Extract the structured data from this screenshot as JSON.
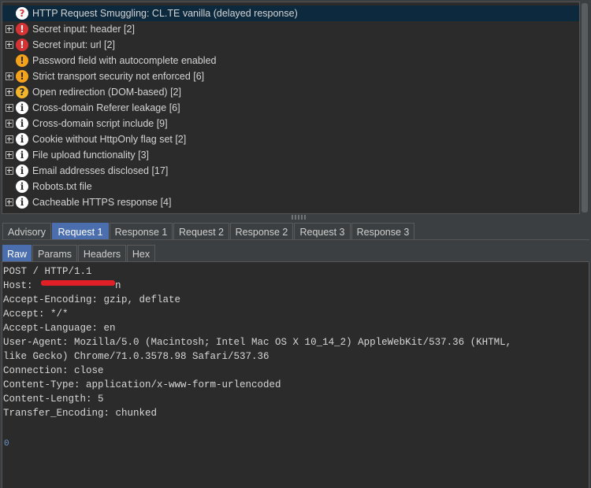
{
  "issues": [
    {
      "label": "HTTP Request Smuggling: CL.TE vanilla (delayed response)",
      "severity": "high-tentative",
      "glyph": "?",
      "expandable": false,
      "selected": true
    },
    {
      "label": "Secret input: header [2]",
      "severity": "high",
      "glyph": "!",
      "expandable": true,
      "selected": false
    },
    {
      "label": "Secret input: url [2]",
      "severity": "high",
      "glyph": "!",
      "expandable": true,
      "selected": false
    },
    {
      "label": "Password field with autocomplete enabled",
      "severity": "medium",
      "glyph": "!",
      "expandable": false,
      "selected": false
    },
    {
      "label": "Strict transport security not enforced [6]",
      "severity": "medium",
      "glyph": "!",
      "expandable": true,
      "selected": false
    },
    {
      "label": "Open redirection (DOM-based) [2]",
      "severity": "medium-tentative",
      "glyph": "?",
      "expandable": true,
      "selected": false
    },
    {
      "label": "Cross-domain Referer leakage [6]",
      "severity": "info",
      "glyph": "i",
      "expandable": true,
      "selected": false
    },
    {
      "label": "Cross-domain script include [9]",
      "severity": "info",
      "glyph": "i",
      "expandable": true,
      "selected": false
    },
    {
      "label": "Cookie without HttpOnly flag set [2]",
      "severity": "info",
      "glyph": "i",
      "expandable": true,
      "selected": false
    },
    {
      "label": "File upload functionality [3]",
      "severity": "info",
      "glyph": "i",
      "expandable": true,
      "selected": false
    },
    {
      "label": "Email addresses disclosed [17]",
      "severity": "info",
      "glyph": "i",
      "expandable": true,
      "selected": false
    },
    {
      "label": "Robots.txt file",
      "severity": "info",
      "glyph": "i",
      "expandable": false,
      "selected": false
    },
    {
      "label": "Cacheable HTTPS response [4]",
      "severity": "info",
      "glyph": "i",
      "expandable": true,
      "selected": false
    }
  ],
  "top_tabs": [
    {
      "label": "Advisory",
      "active": false
    },
    {
      "label": "Request 1",
      "active": true
    },
    {
      "label": "Response 1",
      "active": false
    },
    {
      "label": "Request 2",
      "active": false
    },
    {
      "label": "Response 2",
      "active": false
    },
    {
      "label": "Request 3",
      "active": false
    },
    {
      "label": "Response 3",
      "active": false
    }
  ],
  "sub_tabs": [
    {
      "label": "Raw",
      "active": true
    },
    {
      "label": "Params",
      "active": false
    },
    {
      "label": "Headers",
      "active": false
    },
    {
      "label": "Hex",
      "active": false
    }
  ],
  "request_lines": [
    "POST / HTTP/1.1",
    "Host: ",
    "Accept-Encoding: gzip, deflate",
    "Accept: */*",
    "Accept-Language: en",
    "User-Agent: Mozilla/5.0 (Macintosh; Intel Mac OS X 10_14_2) AppleWebKit/537.36 (KHTML,",
    "like Gecko) Chrome/71.0.3578.98 Safari/537.36",
    "Connection: close",
    "Content-Type: application/x-www-form-urlencoded",
    "Content-Length: 5",
    "Transfer_Encoding: chunked",
    "",
    "0"
  ],
  "host_trailing_char": "n",
  "colors": {
    "selected_row": "#0d293e",
    "active_tab": "#4b6eaf",
    "high": "#d63434",
    "medium": "#f4a21a",
    "redaction": "#e01f26"
  }
}
